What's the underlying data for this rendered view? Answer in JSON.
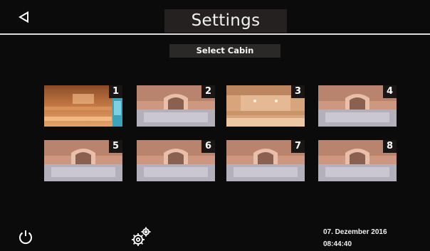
{
  "header": {
    "title": "Settings",
    "back_icon": "back-triangle-icon"
  },
  "subtitle": "Select Cabin",
  "cabins": [
    {
      "number": "1",
      "style": "wood"
    },
    {
      "number": "2",
      "style": "steam"
    },
    {
      "number": "3",
      "style": "wood-light"
    },
    {
      "number": "4",
      "style": "steam"
    },
    {
      "number": "5",
      "style": "steam"
    },
    {
      "number": "6",
      "style": "steam"
    },
    {
      "number": "7",
      "style": "steam"
    },
    {
      "number": "8",
      "style": "steam"
    }
  ],
  "footer": {
    "power_icon": "power-icon",
    "settings_icon": "gears-icon",
    "date": "07. Dezember 2016",
    "time": "08:44:40"
  },
  "colors": {
    "background": "#0c0b0b",
    "title_bg": "#242120",
    "divider": "#dcdcdc"
  }
}
